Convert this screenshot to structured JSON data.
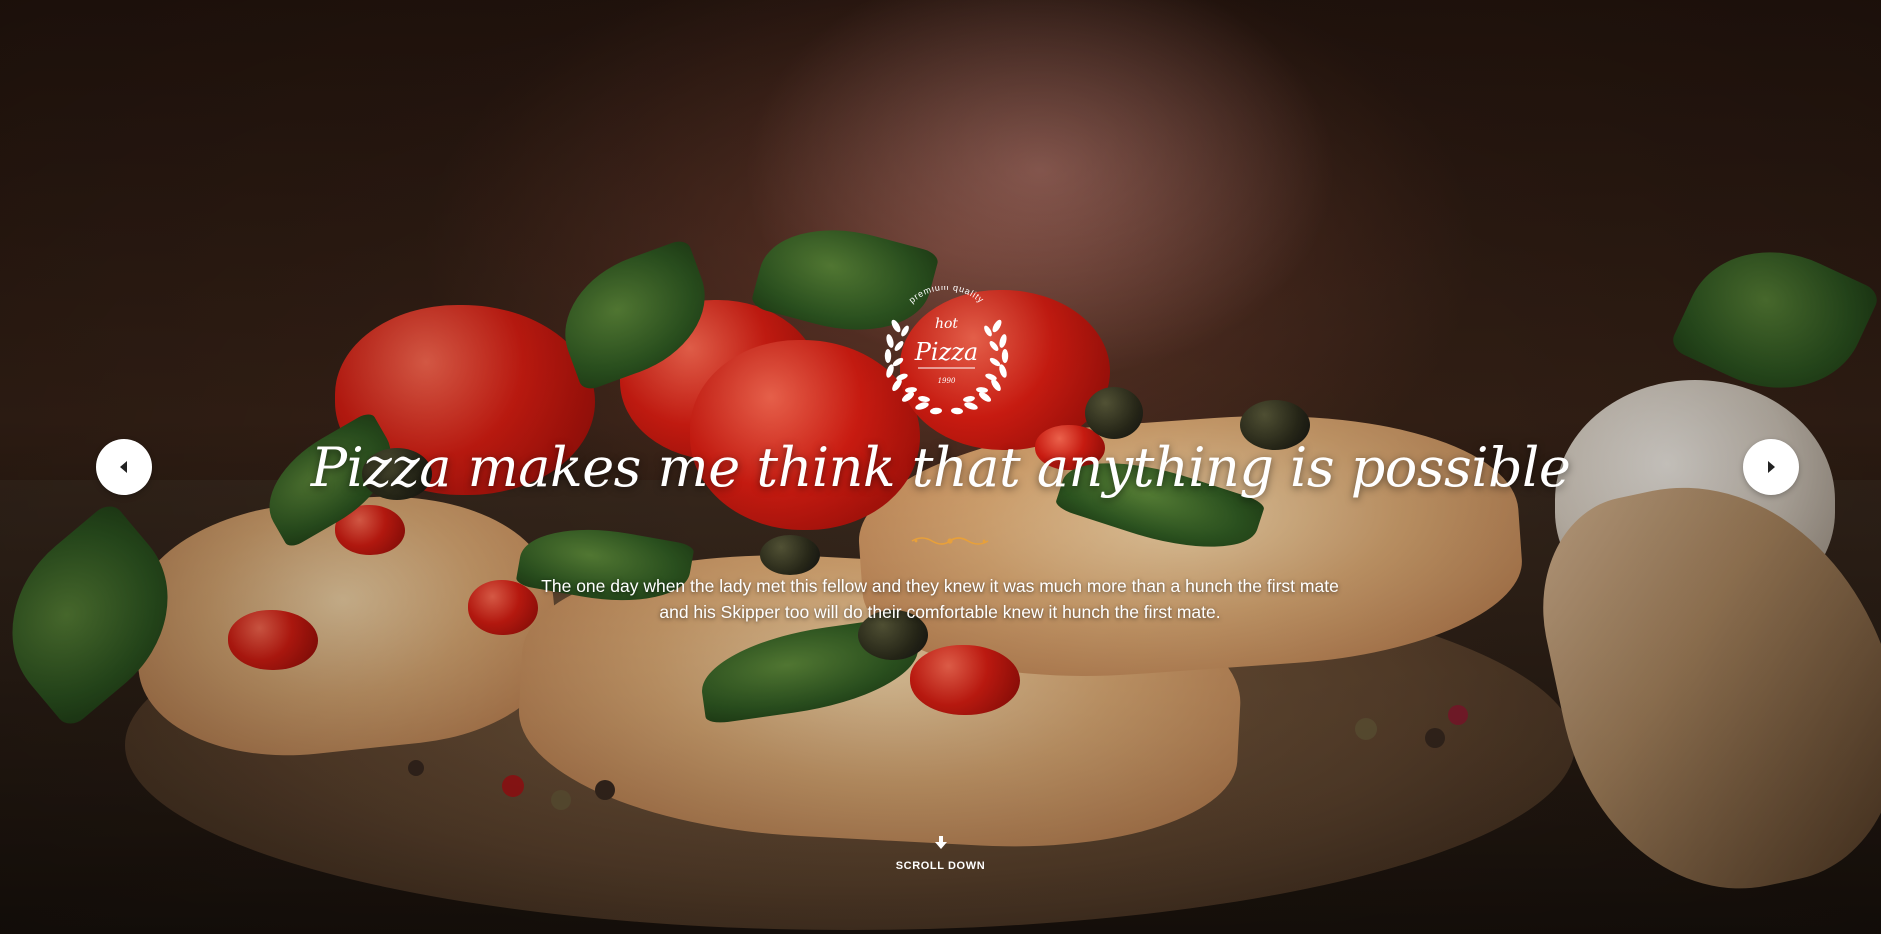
{
  "hero": {
    "emblem": {
      "top_text": "premium quality",
      "small_word": "hot",
      "main_word": "Pizza",
      "year": "1990"
    },
    "headline": "Pizza makes me think that anything is possible",
    "lead": "The one day when the lady met this fellow and they knew it was much more than a hunch the first mate and his Skipper too will do their comfortable knew it hunch the first mate.",
    "scroll_label": "SCROLL DOWN"
  },
  "nav": {
    "prev_icon": "caret-left-icon",
    "next_icon": "caret-right-icon"
  },
  "colors": {
    "accent": "#e8a03a",
    "text": "#ffffff",
    "button_bg": "#ffffff",
    "button_icon": "#222222"
  }
}
